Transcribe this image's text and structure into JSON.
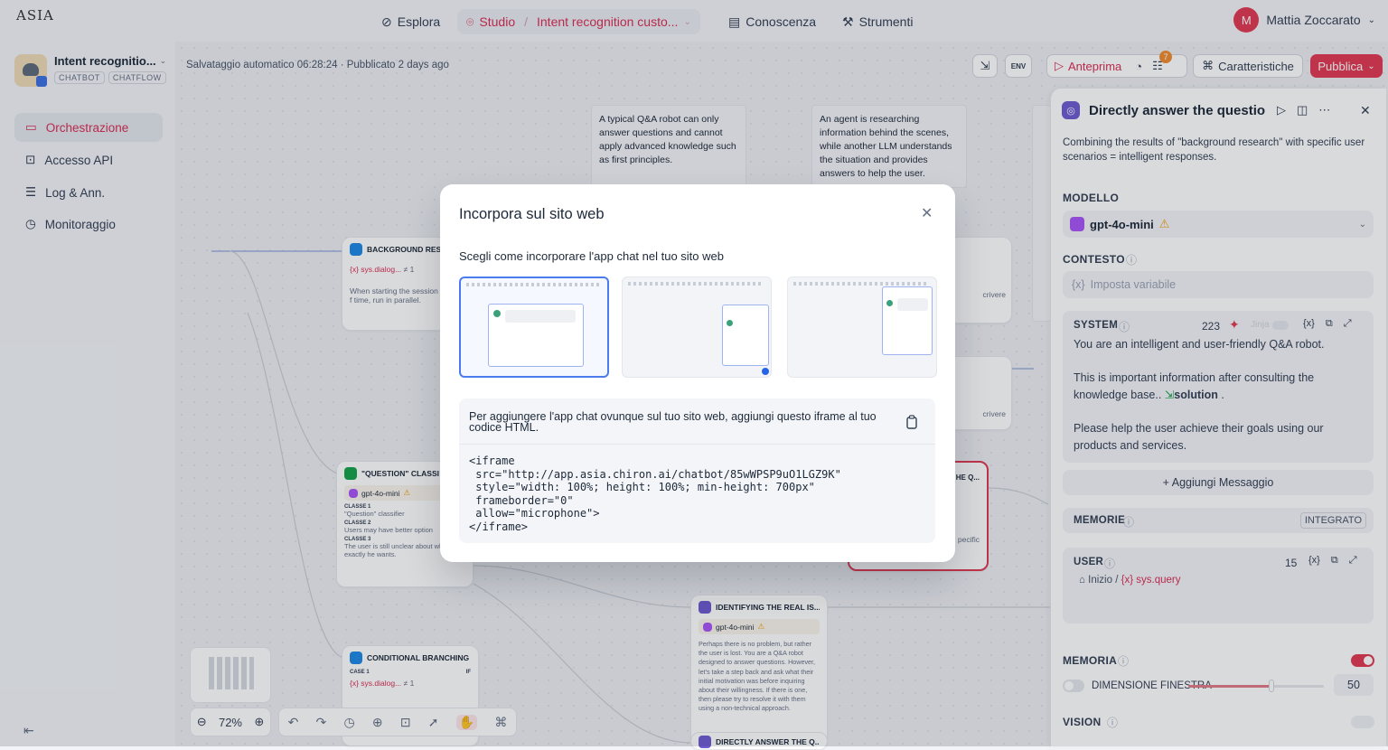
{
  "topbar": {
    "logo": "ASIA",
    "nav": {
      "explore": "Esplora",
      "studio": "Studio",
      "app": "Intent recognition custo...",
      "knowledge": "Conoscenza",
      "tools": "Strumenti"
    },
    "user": {
      "initial": "M",
      "name": "Mattia Zoccarato"
    }
  },
  "sidebar": {
    "app_name": "Intent recognitio...",
    "tags": [
      "CHATBOT",
      "CHATFLOW"
    ],
    "items": [
      {
        "label": "Orchestrazione",
        "icon": "workflow-icon",
        "active": true
      },
      {
        "label": "Accesso API",
        "icon": "terminal-icon",
        "active": false
      },
      {
        "label": "Log & Ann.",
        "icon": "log-icon",
        "active": false
      },
      {
        "label": "Monitoraggio",
        "icon": "monitor-icon",
        "active": false
      }
    ]
  },
  "canvas": {
    "status": "Salvataggio automatico 06:28:24 · Pubblicato 2 days ago",
    "toolbar": {
      "preview": "Anteprima",
      "checklist_badge": "7",
      "features": "Caratteristiche",
      "publish": "Pubblica",
      "env": "ENV"
    },
    "notes": [
      "A typical Q&A robot can only answer questions and cannot apply advanced knowledge such as first principles.",
      "An agent is researching information behind the scenes, while another LLM understands the situation and provides answers to help the user."
    ],
    "nodes": {
      "background": {
        "title": "BACKGROUND RESE",
        "var": "{x} sys.dialog...",
        "var_val": "≠ 1",
        "desc": "When starting the session f time, run in parallel."
      },
      "question": {
        "title": "\"QUESTION\" CLASSI",
        "model": "gpt-4o-mini",
        "classes": [
          {
            "label": "CLASSE 1",
            "text": "\"Question\" classifier"
          },
          {
            "label": "CLASSE 2",
            "text": "Users may have better option"
          },
          {
            "label": "CLASSE 3",
            "text": "The user is still unclear about what exactly he wants."
          }
        ]
      },
      "identifying": {
        "title": "IDENTIFYING THE REAL IS...",
        "model": "gpt-4o-mini",
        "desc": "Perhaps there is no problem, but rather the user is lost. You are a Q&A robot designed to answer questions. However, let's take a step back and ask what their initial motivation was before inquiring about their willingness. If there is one, then please try to resolve it with them using a non-technical approach."
      },
      "conditional": {
        "title": "CONDITIONAL BRANCHING",
        "case": "CASE 1",
        "if": "IF",
        "var": "{x} sys.dialog...",
        "var_val": "≠ 1"
      },
      "direct_small": {
        "title": "DIRECTLY ANSWER THE Q..."
      },
      "crivere1": "crivere",
      "crivere2": "crivere",
      "pecific": "pecific",
      "he_q": "HE Q..."
    },
    "zoom": "72%"
  },
  "modal": {
    "title": "Incorpora sul sito web",
    "subtitle": "Scegli come incorporare l'app chat nel tuo sito web",
    "instructions": "Per aggiungere l'app chat ovunque sul tuo sito web, aggiungi questo iframe al tuo codice HTML.",
    "code": "<iframe\n src=\"http://app.asia.chiron.ai/chatbot/85wWPSP9uO1LGZ9K\"\n style=\"width: 100%; height: 100%; min-height: 700px\"\n frameborder=\"0\"\n allow=\"microphone\">\n</iframe>",
    "selected_option": 0
  },
  "panel": {
    "title": "Directly answer the questior",
    "description": "Combining the results of \"background research\" with specific user scenarios = intelligent responses.",
    "model_label": "MODELLO",
    "model": "gpt-4o-mini",
    "context_label": "CONTESTO",
    "context_placeholder": "Imposta variabile",
    "system": {
      "label": "SYSTEM",
      "tokens": "223",
      "jinja": "Jinja",
      "line1": "You are an intelligent and user-friendly Q&A robot.",
      "line2a": "This is important information after consulting the",
      "line2b": "knowledge base..",
      "solution": "solution",
      "line2c": ".",
      "line3": "Please help the user achieve their goals using our products and services."
    },
    "add_message": "+ Aggiungi Messaggio",
    "memories": {
      "label": "MEMORIE",
      "badge": "INTEGRATO"
    },
    "user": {
      "label": "USER",
      "tokens": "15",
      "start": "Inizio",
      "var": "sys.query"
    },
    "memory_label": "MEMORIA",
    "window_label": "DIMENSIONE FINESTRA",
    "window_value": "50",
    "window_fraction": 0.5,
    "vision_label": "VISION"
  },
  "colors": {
    "accent": "#e03a51",
    "brand_blue": "#4b7bec",
    "node_purple": "#6d5bd0"
  }
}
